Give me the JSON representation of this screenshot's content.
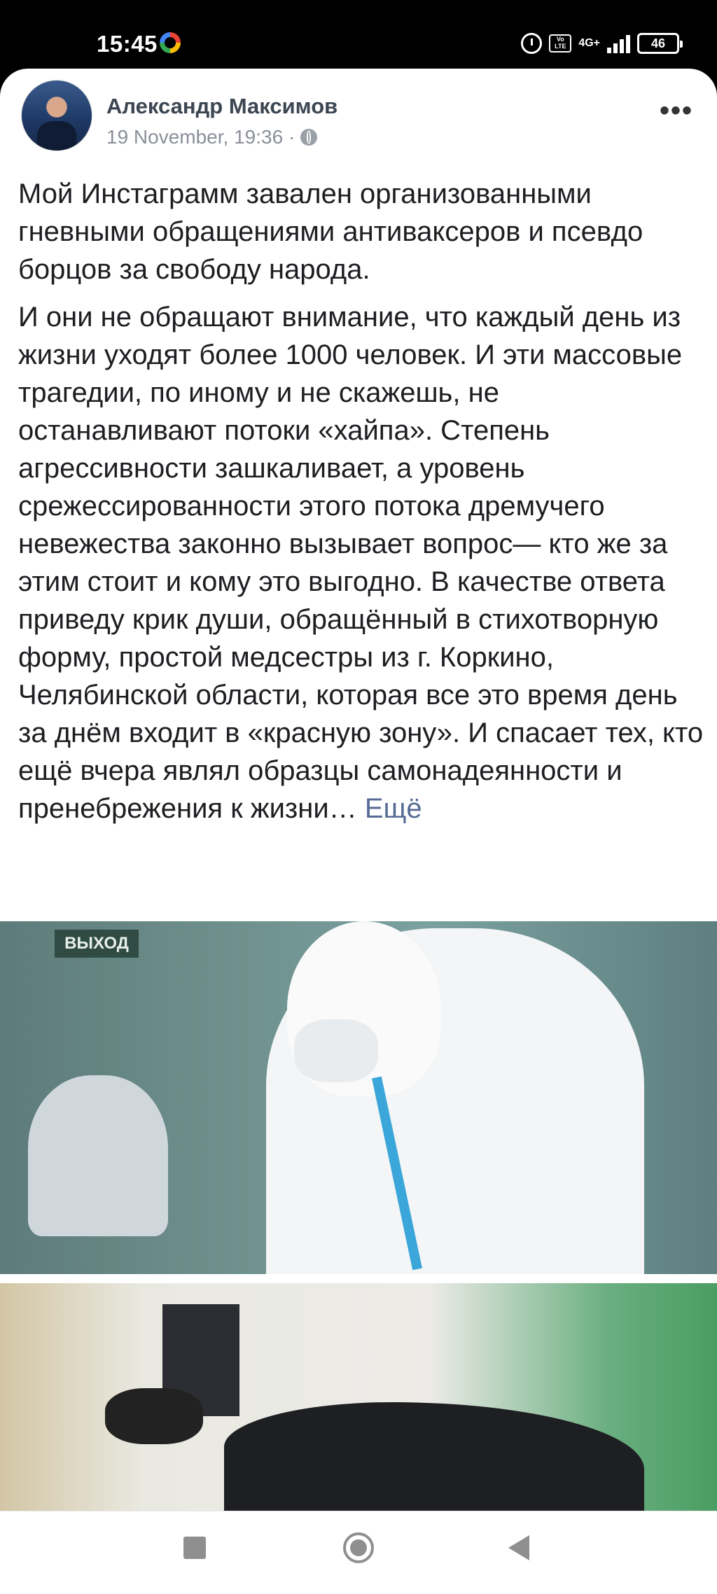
{
  "status_bar": {
    "time": "15:45",
    "network_label": "4G+",
    "volte_label": "Vo LTE",
    "battery_level": "46"
  },
  "post": {
    "author": "Александр Максимов",
    "timestamp": "19 November, 19:36 ·",
    "paragraph1": "Мой Инстаграмм завален организованными гневными обращениями антиваксеров и псевдо борцов за свободу народа.",
    "paragraph2": "И они не обращают внимание, что каждый день из жизни уходят более 1000 человек. И эти массовые трагедии, по иному и не скажешь, не останавливают потоки «хайпа». Степень агрессивности зашкаливает, а уровень срежессированности этого потока дремучего невежества законно вызывает вопрос— кто же за этим стоит и кому это выгодно. В качестве ответа приведу крик души, обращённый в стихотворную форму, простой медсестры из г. Коркино, Челябинской области, которая все это время день за днём входит в «красную зону». И спасает тех, кто ещё вчера являл образцы самонадеянности и пренебрежения к жизни… ",
    "more_label": "Ещё",
    "photo1_sign": "ВЫХОД"
  },
  "icons": [
    "google-icon",
    "alarm-icon",
    "volte-icon",
    "signal-icon",
    "battery-icon",
    "globe-icon",
    "more-options-icon",
    "recent-apps-icon",
    "home-icon",
    "back-icon"
  ]
}
